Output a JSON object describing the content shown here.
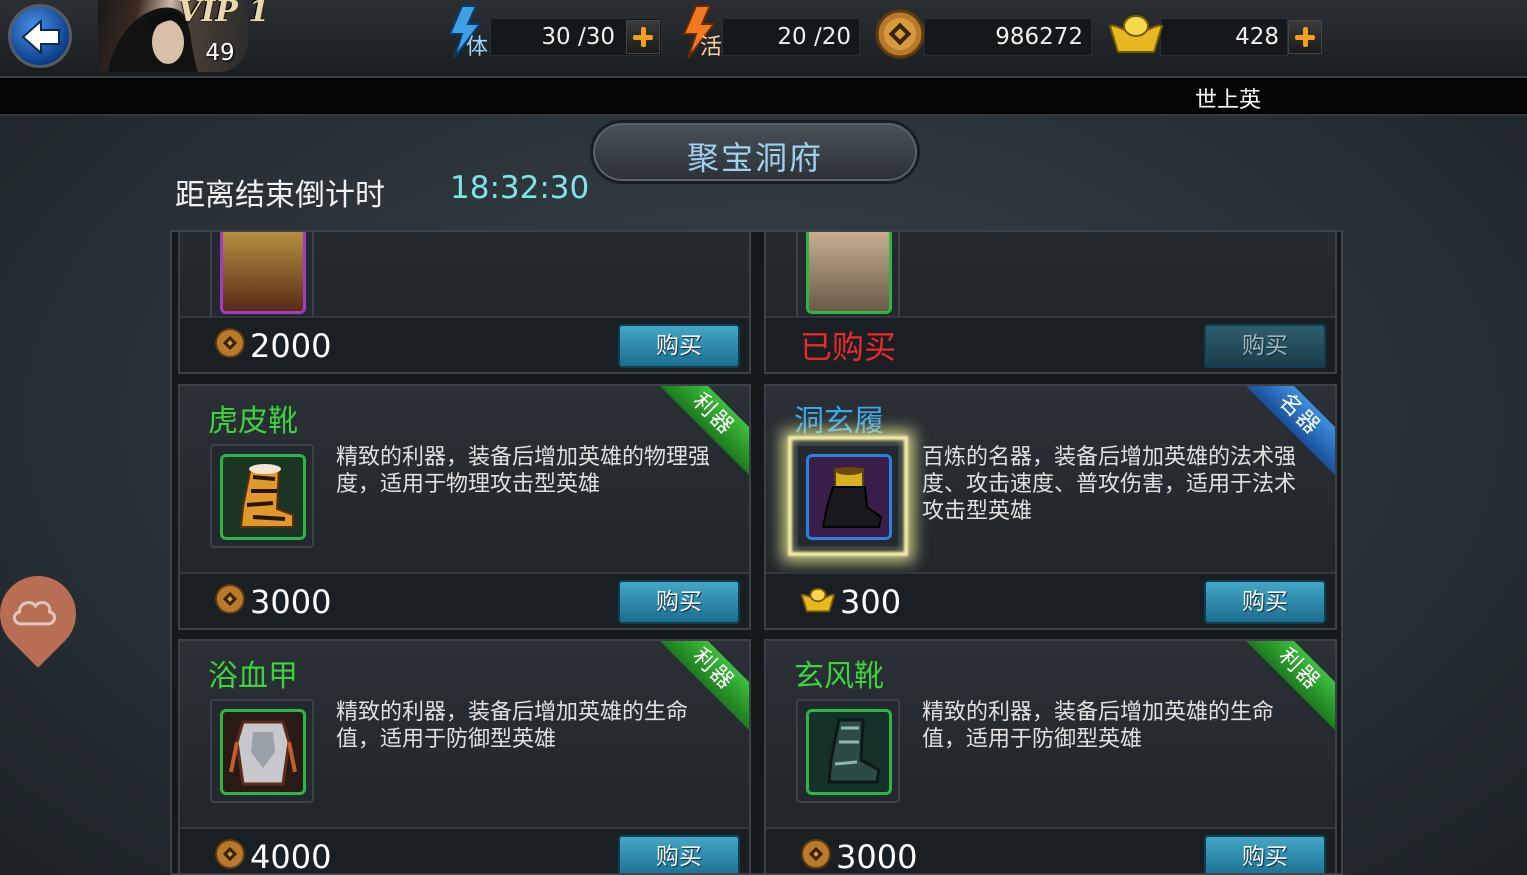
{
  "topbar": {
    "vip": "VIP 1",
    "level": "49",
    "stamina": {
      "icon_char": "体",
      "value": "30 /30"
    },
    "activity": {
      "icon_char": "活",
      "value": "20 /20"
    },
    "coins": {
      "value": "986272"
    },
    "ingots": {
      "value": "428"
    }
  },
  "ticker": {
    "text": "世上英"
  },
  "shop": {
    "title": "聚宝洞府",
    "countdown_label": "距离结束倒计时",
    "countdown_time": "18:32:30"
  },
  "cards": [
    {
      "name": "",
      "desc": "",
      "price": "2000",
      "currency": "coin",
      "buy_label": "购买",
      "bought": false
    },
    {
      "name": "",
      "desc": "",
      "bought_label": "已购买",
      "buy_label": "购买",
      "bought": true
    },
    {
      "name": "虎皮靴",
      "name_color": "green",
      "tag": "利器",
      "tag_color": "green",
      "desc": "精致的利器，装备后增加英雄的物理强度，适用于物理攻击型英雄",
      "price": "3000",
      "currency": "coin",
      "buy_label": "购买",
      "bought": false
    },
    {
      "name": "洞玄履",
      "name_color": "blue",
      "tag": "名器",
      "tag_color": "blue",
      "desc": "百炼的名器，装备后增加英雄的法术强度、攻击速度、普攻伤害，适用于法术攻击型英雄",
      "price": "300",
      "currency": "ingot",
      "buy_label": "购买",
      "bought": false
    },
    {
      "name": "浴血甲",
      "name_color": "green",
      "tag": "利器",
      "tag_color": "green",
      "desc": "精致的利器，装备后增加英雄的生命值，适用于防御型英雄",
      "price": "4000",
      "currency": "coin",
      "buy_label": "购买",
      "bought": false
    },
    {
      "name": "玄风靴",
      "name_color": "green",
      "tag": "利器",
      "tag_color": "green",
      "desc": "精致的利器，装备后增加英雄的生命值，适用于防御型英雄",
      "price": "3000",
      "currency": "coin",
      "buy_label": "购买",
      "bought": false
    }
  ],
  "colors": {
    "accent_cyan": "#7fe3e8",
    "name_green": "#3fd13f",
    "name_blue": "#3fa7ea",
    "bought_red": "#e82a2a",
    "button_blue": "#2b88aa"
  }
}
